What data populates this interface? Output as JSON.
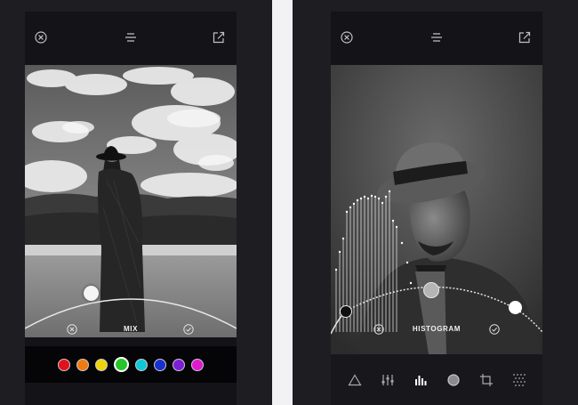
{
  "screens": [
    {
      "label": "MIX",
      "swatches": [
        {
          "color": "#e3111c",
          "selected": false
        },
        {
          "color": "#f07a12",
          "selected": false
        },
        {
          "color": "#f2d20f",
          "selected": false
        },
        {
          "color": "#27c42a",
          "selected": true
        },
        {
          "color": "#10c8d8",
          "selected": false
        },
        {
          "color": "#1a2fd0",
          "selected": false
        },
        {
          "color": "#7a1fd6",
          "selected": false
        },
        {
          "color": "#e019d0",
          "selected": false
        }
      ]
    },
    {
      "label": "HISTOGRAM",
      "tools": [
        "triangle-icon",
        "sliders-icon",
        "histogram-icon",
        "circle-icon",
        "crop-icon",
        "grain-icon"
      ],
      "active_tool": "histogram-icon"
    }
  ],
  "colors": {
    "background": "#1d1d22",
    "phone": "#141418",
    "icon": "#bfc0c6"
  }
}
